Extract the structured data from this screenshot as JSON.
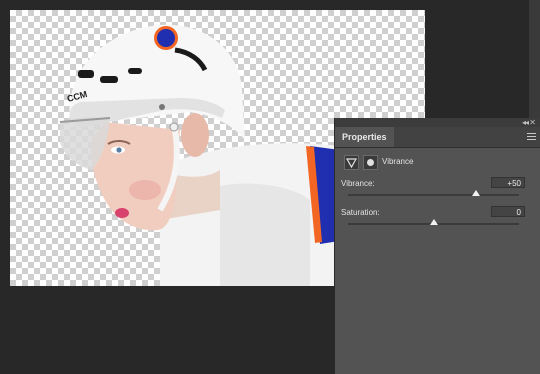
{
  "panel": {
    "tab_label": "Properties",
    "adjustment_name": "Vibrance",
    "vibrance": {
      "label": "Vibrance:",
      "value": "+50",
      "level": 0.75
    },
    "saturation": {
      "label": "Saturation:",
      "value": "0",
      "level": 0.5
    }
  },
  "icons": [
    "collapse-icon",
    "panel-menu-icon",
    "vibrance-adjustment-icon",
    "layer-mask-icon",
    "slider-thumb"
  ],
  "colors": {
    "panel_bg": "#535353",
    "workspace_bg": "#282828",
    "jersey_blue": "#1f2fb0",
    "jersey_orange": "#f26522"
  }
}
